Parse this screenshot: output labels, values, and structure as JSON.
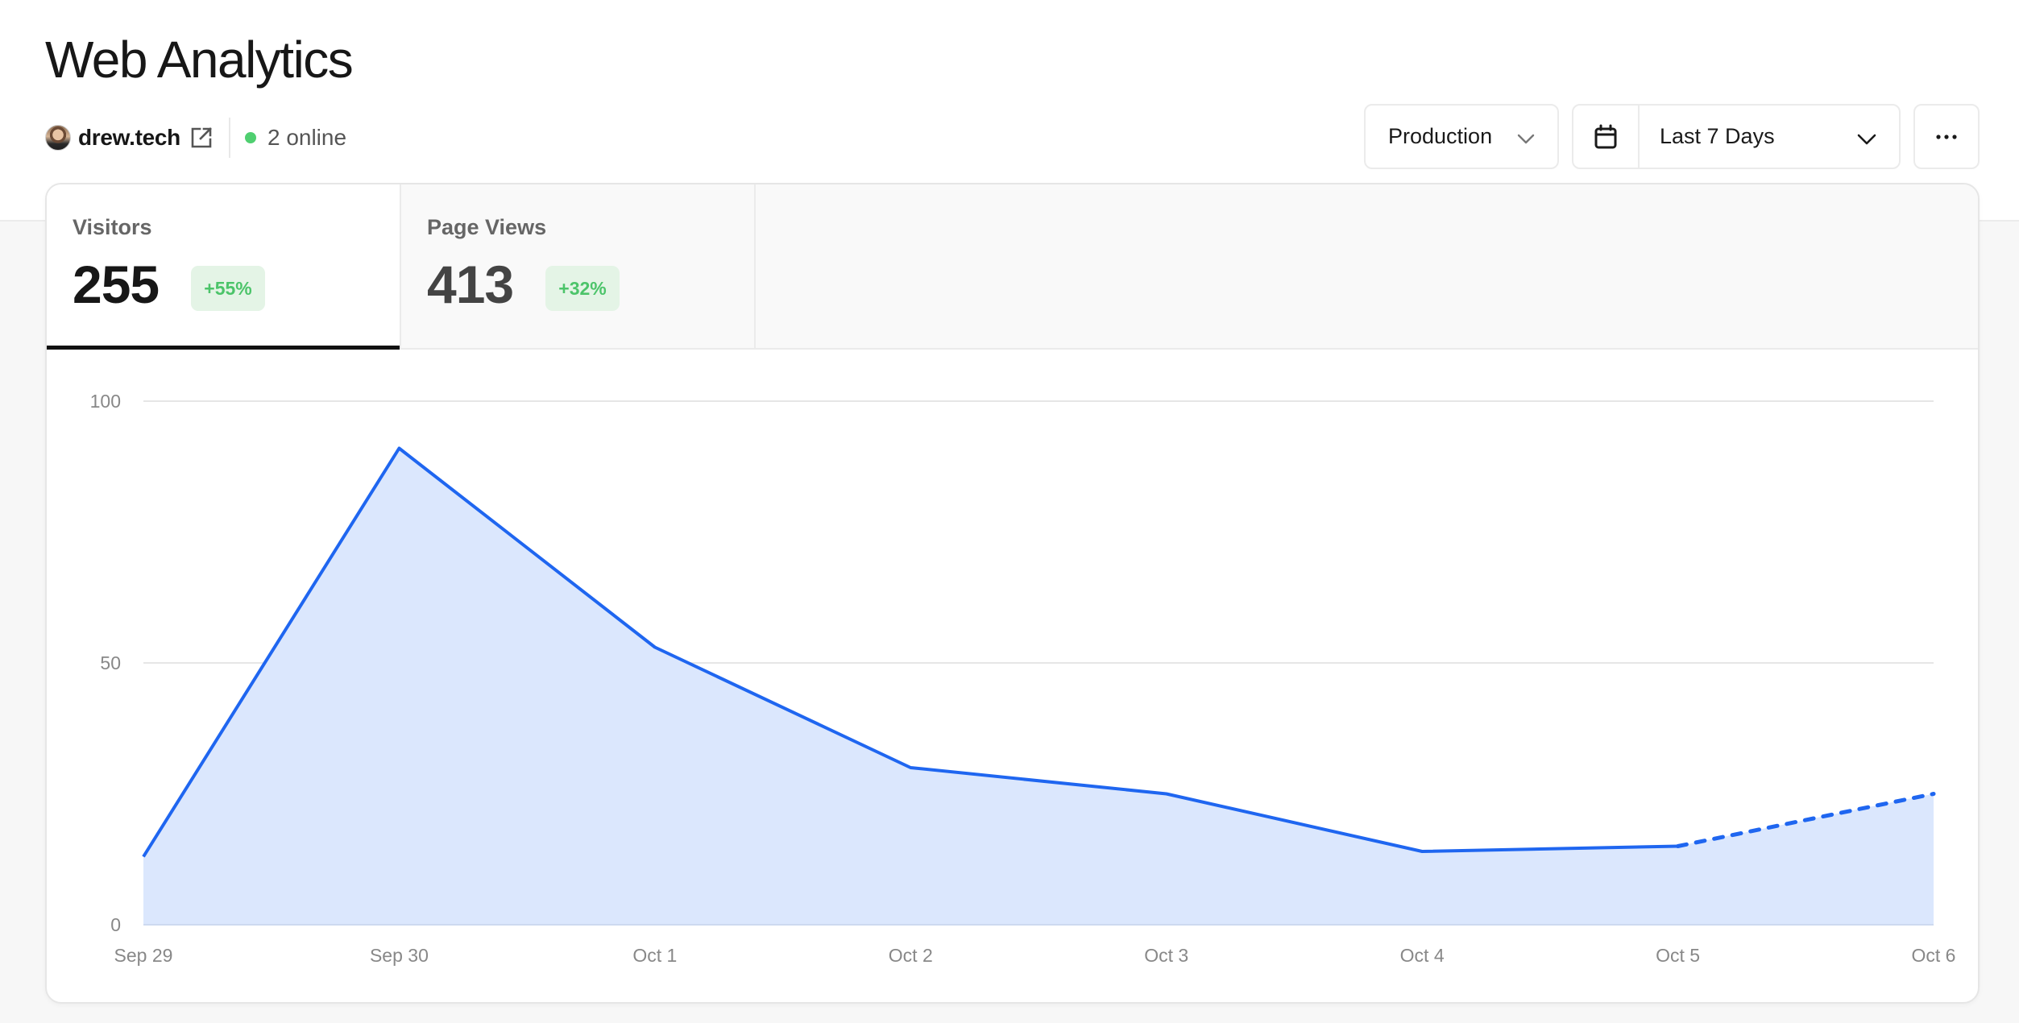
{
  "header": {
    "title": "Web Analytics",
    "site": {
      "name": "drew.tech",
      "avatar_icon": "user-avatar",
      "external_link_icon": "external-link-icon"
    },
    "online": {
      "count_text": "2 online",
      "status_color": "#4fcf70"
    }
  },
  "toolbar": {
    "environment": {
      "selected": "Production",
      "icon": "chevron-down-icon"
    },
    "date_range": {
      "selected": "Last 7 Days",
      "icon": "calendar-icon",
      "chevron": "chevron-down-icon"
    },
    "more": {
      "icon": "more-horizontal-icon"
    }
  },
  "metrics": {
    "tabs": [
      {
        "label": "Visitors",
        "value": "255",
        "change": "+55%",
        "active": true
      },
      {
        "label": "Page Views",
        "value": "413",
        "change": "+32%",
        "active": false
      }
    ],
    "badge_color": "#4cc46a"
  },
  "colors": {
    "line": "#1f66f0",
    "area": "#dbe7fd"
  },
  "chart_data": {
    "type": "area",
    "title": "",
    "xlabel": "",
    "ylabel": "",
    "categories": [
      "Sep 29",
      "Sep 30",
      "Oct 1",
      "Oct 2",
      "Oct 3",
      "Oct 4",
      "Oct 5",
      "Oct 6"
    ],
    "series": [
      {
        "name": "Visitors",
        "values": [
          13,
          91,
          53,
          30,
          25,
          14,
          15,
          25
        ],
        "dashed_from_index": 6
      }
    ],
    "ylim": [
      0,
      100
    ],
    "yticks": [
      "0",
      "50",
      "100"
    ],
    "ytick_values": [
      0,
      50,
      100
    ],
    "grid": true,
    "legend": "none"
  }
}
